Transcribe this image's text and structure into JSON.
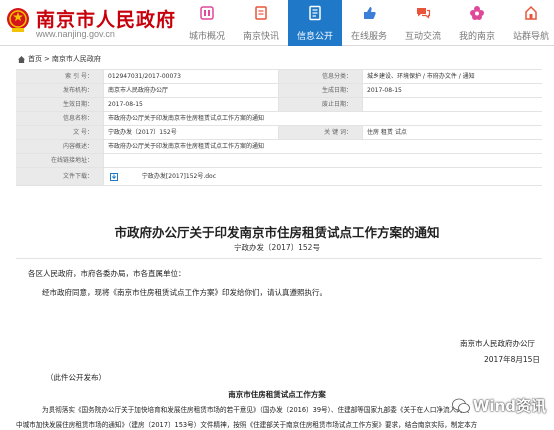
{
  "header": {
    "site_title": "南京市人民政府",
    "site_url": "www.nanjing.gov.cn",
    "nav": [
      {
        "label": "城市概况",
        "icon": "city-icon"
      },
      {
        "label": "南京快讯",
        "icon": "news-icon"
      },
      {
        "label": "信息公开",
        "icon": "document-icon",
        "active": true
      },
      {
        "label": "在线服务",
        "icon": "thumb-icon"
      },
      {
        "label": "互动交流",
        "icon": "chat-icon"
      },
      {
        "label": "我的南京",
        "icon": "flower-icon"
      },
      {
        "label": "站群导航",
        "icon": "navigation-icon"
      }
    ],
    "active_color": "#1f78c8",
    "brand_color": "#c7000b"
  },
  "breadcrumb": {
    "home": "首页",
    "current": "南京市人民政府"
  },
  "info_table": {
    "index_label": "索 引 号：",
    "index_value": "012947031/2017-00073",
    "category_label": "信息分类：",
    "category_value": "城乡建设、环境保护 / 市府办文件 / 通知",
    "publisher_label": "发布机构：",
    "publisher_value": "南京市人民政府办公厅",
    "gen_date_label": "生成日期：",
    "gen_date_value": "2017-08-15",
    "effective_label": "生效日期：",
    "effective_value": "2017-08-15",
    "abolish_label": "废止日期：",
    "abolish_value": "",
    "name_label": "信息名称：",
    "name_value": "市政府办公厅关于印发南京市住房租赁试点工作方案的通知",
    "docno_label": "文 号：",
    "docno_value": "宁政办发〔2017〕152号",
    "keywords_label": "关 键 词：",
    "keywords_value": "住房 租赁 试点",
    "summary_label": "内容概述：",
    "summary_value": "市政府办公厅关于印发南京市住房租赁试点工作方案的通知",
    "online_label": "在线链接地址：",
    "online_value": "",
    "attachment_label": "文件下载：",
    "attachment_value": "宁政办发[2017]152号.doc"
  },
  "article": {
    "title": "市政府办公厅关于印发南京市住房租赁试点工作方案的通知",
    "doc_number": "宁政办发〔2017〕152号",
    "salutation": "各区人民政府，市府各委办局，市各直属单位：",
    "body": "经市政府同意，现将《南京市住房租赁试点工作方案》印发给你们，请认真遵照执行。",
    "signature": "南京市人民政府办公厅",
    "sign_date": "2017年8月15日",
    "publish_note": "（此件公开发布）",
    "section_title": "南京市住房租赁试点工作方案",
    "body_line1": "为贯彻落实《国务院办公厅关于加快培育和发展住房租赁市场的若干意见》（国办发〔2016〕39号）、住建部等国家九部委《关于在人口净流入的大",
    "body_line2": "中城市加快发展住房租赁市场的通知》（建房〔2017〕153号）文件精神，按照《住建部关于南京住房租赁市场试点工作方案》要求，结合南京实际，制定本方"
  },
  "watermark": {
    "text": "Wind资讯"
  }
}
